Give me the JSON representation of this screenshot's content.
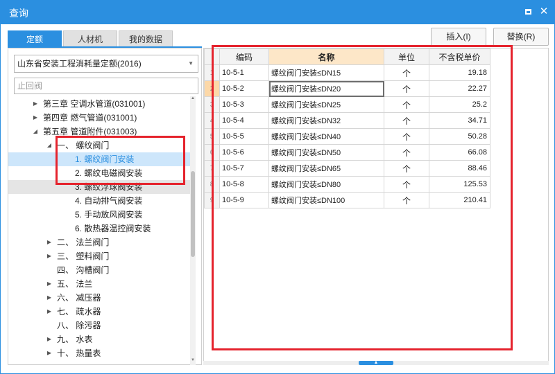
{
  "window": {
    "title": "查询",
    "minimize_icon": "minimize-icon",
    "close_icon": "close-icon",
    "close_glyph": "✕"
  },
  "tabs": [
    {
      "label": "定额",
      "active": true
    },
    {
      "label": "人材机",
      "active": false
    },
    {
      "label": "我的数据",
      "active": false
    }
  ],
  "actions": {
    "insert_label": "插入(I)",
    "replace_label": "替换(R)"
  },
  "left": {
    "library_select": "山东省安装工程消耗量定额(2016)",
    "search_value": "止回阀",
    "tree": [
      {
        "label": "第三章 空调水管道(031001)",
        "depth": 0,
        "expander": "collapsed",
        "state": ""
      },
      {
        "label": "第四章 燃气管道(031001)",
        "depth": 0,
        "expander": "collapsed",
        "state": ""
      },
      {
        "label": "第五章 管道附件(031003)",
        "depth": 0,
        "expander": "expanded",
        "state": ""
      },
      {
        "label": "一、 螺纹阀门",
        "depth": 1,
        "expander": "expanded",
        "state": ""
      },
      {
        "label": "1. 螺纹阀门安装",
        "depth": 2,
        "expander": "none",
        "state": "sel"
      },
      {
        "label": "2. 螺纹电磁阀安装",
        "depth": 2,
        "expander": "none",
        "state": ""
      },
      {
        "label": "3. 螺纹浮球阀安装",
        "depth": 2,
        "expander": "none",
        "state": "hover"
      },
      {
        "label": "4. 自动排气阀安装",
        "depth": 2,
        "expander": "none",
        "state": ""
      },
      {
        "label": "5. 手动放风阀安装",
        "depth": 2,
        "expander": "none",
        "state": ""
      },
      {
        "label": "6. 散热器温控阀安装",
        "depth": 2,
        "expander": "none",
        "state": ""
      },
      {
        "label": "二、 法兰阀门",
        "depth": 1,
        "expander": "collapsed",
        "state": ""
      },
      {
        "label": "三、 塑料阀门",
        "depth": 1,
        "expander": "collapsed",
        "state": ""
      },
      {
        "label": "四、 沟槽阀门",
        "depth": 1,
        "expander": "none",
        "state": ""
      },
      {
        "label": "五、 法兰",
        "depth": 1,
        "expander": "collapsed",
        "state": ""
      },
      {
        "label": "六、 减压器",
        "depth": 1,
        "expander": "collapsed",
        "state": ""
      },
      {
        "label": "七、 疏水器",
        "depth": 1,
        "expander": "collapsed",
        "state": ""
      },
      {
        "label": "八、 除污器",
        "depth": 1,
        "expander": "none",
        "state": ""
      },
      {
        "label": "九、 水表",
        "depth": 1,
        "expander": "collapsed",
        "state": ""
      },
      {
        "label": "十、 热量表",
        "depth": 1,
        "expander": "collapsed",
        "state": ""
      }
    ]
  },
  "grid": {
    "columns": [
      "编码",
      "名称",
      "单位",
      "不含税单价"
    ],
    "rows": [
      {
        "num": "1",
        "code": "10-5-1",
        "name": "螺纹阀门安装≤DN15",
        "unit": "个",
        "price": "19.18"
      },
      {
        "num": "2",
        "code": "10-5-2",
        "name": "螺纹阀门安装≤DN20",
        "unit": "个",
        "price": "22.27"
      },
      {
        "num": "3",
        "code": "10-5-3",
        "name": "螺纹阀门安装≤DN25",
        "unit": "个",
        "price": "25.2"
      },
      {
        "num": "4",
        "code": "10-5-4",
        "name": "螺纹阀门安装≤DN32",
        "unit": "个",
        "price": "34.71"
      },
      {
        "num": "5",
        "code": "10-5-5",
        "name": "螺纹阀门安装≤DN40",
        "unit": "个",
        "price": "50.28"
      },
      {
        "num": "6",
        "code": "10-5-6",
        "name": "螺纹阀门安装≤DN50",
        "unit": "个",
        "price": "66.08"
      },
      {
        "num": "7",
        "code": "10-5-7",
        "name": "螺纹阀门安装≤DN65",
        "unit": "个",
        "price": "88.46"
      },
      {
        "num": "8",
        "code": "10-5-8",
        "name": "螺纹阀门安装≤DN80",
        "unit": "个",
        "price": "125.53"
      },
      {
        "num": "9",
        "code": "10-5-9",
        "name": "螺纹阀门安装≤DN100",
        "unit": "个",
        "price": "210.41"
      }
    ],
    "selected_row": 1
  },
  "colors": {
    "accent": "#2b8fe0",
    "selection": "#cde6fb",
    "annotation_red": "#e5232d"
  }
}
